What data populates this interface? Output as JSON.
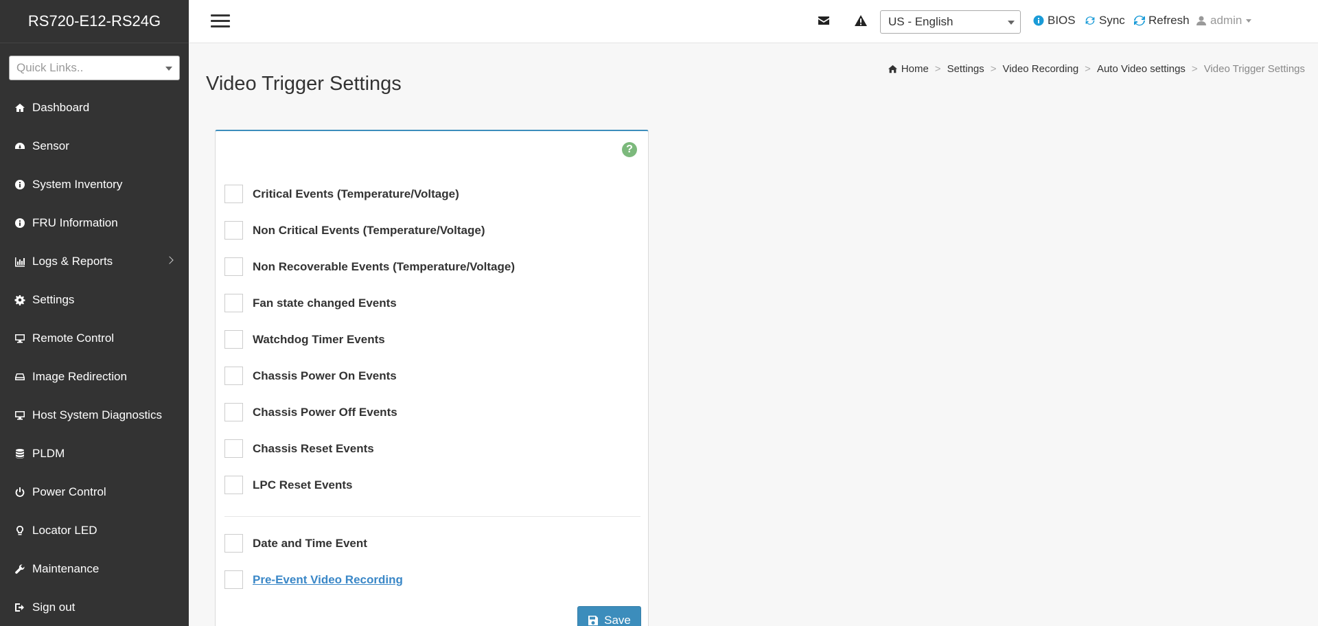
{
  "app": {
    "brand": "RS720-E12-RS24G",
    "quick_links_placeholder": "Quick Links.."
  },
  "sidebar": {
    "items": [
      {
        "label": "Dashboard",
        "icon": "dashboard-icon"
      },
      {
        "label": "Sensor",
        "icon": "tachometer-icon"
      },
      {
        "label": "System Inventory",
        "icon": "info-circle-icon"
      },
      {
        "label": "FRU Information",
        "icon": "info-circle-icon"
      },
      {
        "label": "Logs & Reports",
        "icon": "bar-chart-icon",
        "has_submenu": true
      },
      {
        "label": "Settings",
        "icon": "gear-icon"
      },
      {
        "label": "Remote Control",
        "icon": "desktop-icon"
      },
      {
        "label": "Image Redirection",
        "icon": "hdd-icon"
      },
      {
        "label": "Host System Diagnostics",
        "icon": "desktop-icon"
      },
      {
        "label": "PLDM",
        "icon": "database-icon"
      },
      {
        "label": "Power Control",
        "icon": "power-icon"
      },
      {
        "label": "Locator LED",
        "icon": "lightbulb-icon"
      },
      {
        "label": "Maintenance",
        "icon": "wrench-icon"
      },
      {
        "label": "Sign out",
        "icon": "sign-out-icon"
      }
    ]
  },
  "topbar": {
    "language": "US - English",
    "bios_label": "BIOS",
    "sync_label": "Sync",
    "refresh_label": "Refresh",
    "user_label": "admin"
  },
  "page": {
    "title": "Video Trigger Settings",
    "breadcrumb": [
      "Home",
      "Settings",
      "Video Recording",
      "Auto Video settings",
      "Video Trigger Settings"
    ]
  },
  "form": {
    "options": [
      {
        "label": "Critical Events (Temperature/Voltage)",
        "checked": false
      },
      {
        "label": "Non Critical Events (Temperature/Voltage)",
        "checked": false
      },
      {
        "label": "Non Recoverable Events (Temperature/Voltage)",
        "checked": false
      },
      {
        "label": "Fan state changed Events",
        "checked": false
      },
      {
        "label": "Watchdog Timer Events",
        "checked": false
      },
      {
        "label": "Chassis Power On Events",
        "checked": false
      },
      {
        "label": "Chassis Power Off Events",
        "checked": false
      },
      {
        "label": "Chassis Reset Events",
        "checked": false
      },
      {
        "label": "LPC Reset Events",
        "checked": false
      }
    ],
    "date_time_event": {
      "label": "Date and Time Event",
      "checked": false
    },
    "pre_event": {
      "label": "Pre-Event Video Recording",
      "checked": false
    },
    "save_label": "Save"
  },
  "colors": {
    "sidebar_bg": "#333333",
    "accent": "#3c8dbc",
    "help_icon": "#7cb97c",
    "link": "#3a87c7"
  }
}
